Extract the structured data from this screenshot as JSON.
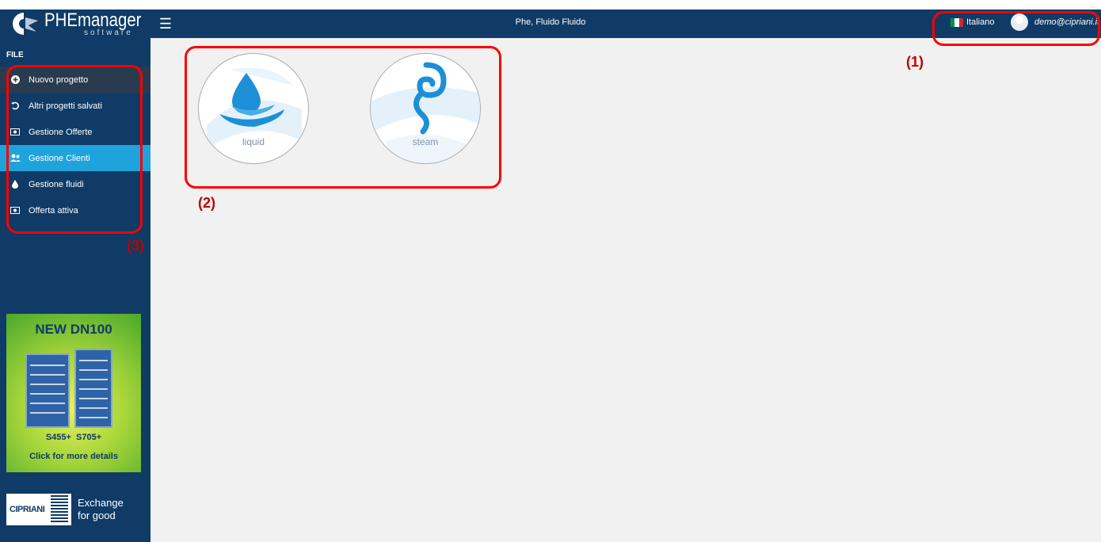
{
  "app": {
    "logo_text": "PHEmanager",
    "logo_subtext": "software",
    "title": "Phe, Fluido Fluido"
  },
  "topbar": {
    "language": "Italiano",
    "user_email": "demo@cipriani.it",
    "menu_icon": "hamburger-icon"
  },
  "sidebar": {
    "section_label": "FILE",
    "items": [
      {
        "label": "Nuovo progetto",
        "icon": "plus-circle-icon"
      },
      {
        "label": "Altri progetti salvati",
        "icon": "history-icon"
      },
      {
        "label": "Gestione Offerte",
        "icon": "money-icon"
      },
      {
        "label": "Gestione Clienti",
        "icon": "users-icon"
      },
      {
        "label": "Gestione fluidi",
        "icon": "drop-icon"
      },
      {
        "label": "Offerta attiva",
        "icon": "money-icon"
      }
    ],
    "banner": {
      "title": "NEW DN100",
      "models": "S455+  S705+",
      "cta": "Click for more details"
    },
    "brand": {
      "name": "CIPRIANI",
      "slogan_line1": "Exchange",
      "slogan_line2": "for good"
    }
  },
  "main": {
    "options": [
      {
        "label": "liquid",
        "icon": "water-drop-icon"
      },
      {
        "label": "steam",
        "icon": "steam-swirl-icon"
      }
    ]
  },
  "annotations": [
    "(1)",
    "(2)",
    "(3)"
  ],
  "colors": {
    "topbar": "#0f3b66",
    "active_item": "#1fa3dc",
    "background": "#f1f1f1",
    "annotation": "#ff0000"
  }
}
